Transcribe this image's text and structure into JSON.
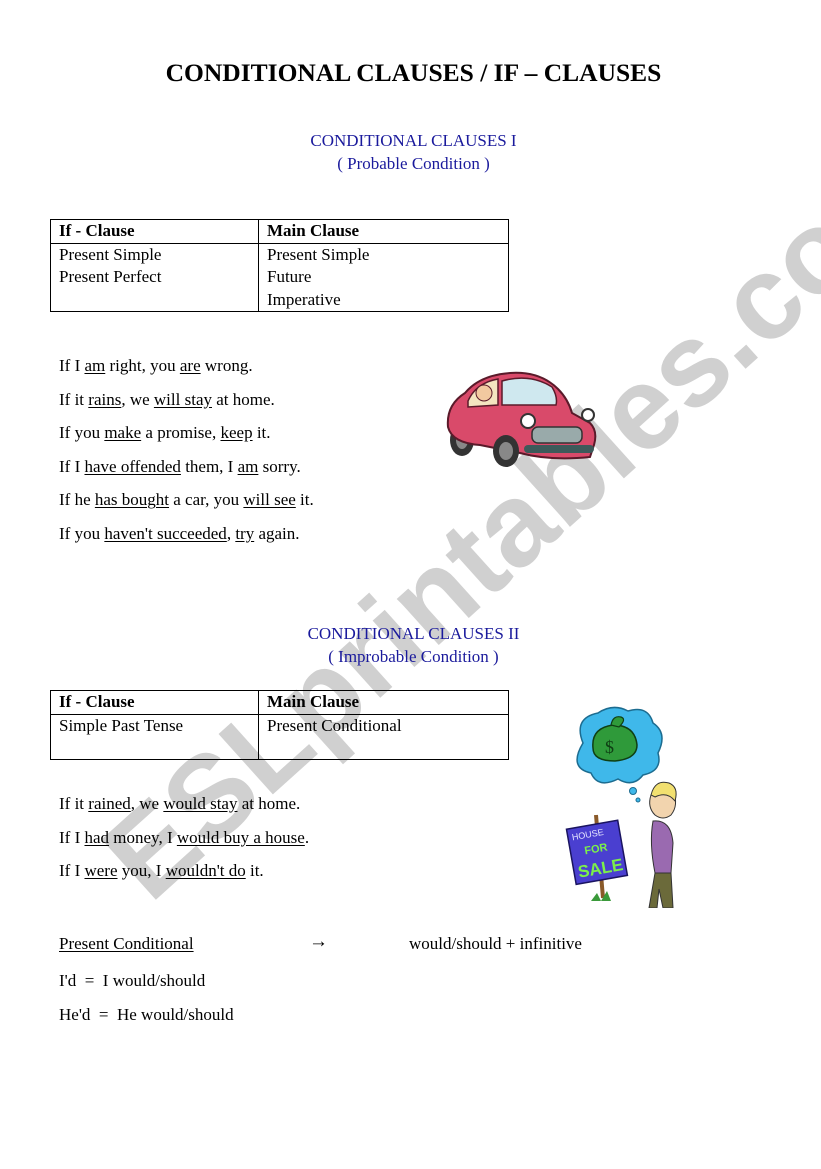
{
  "watermark": "ESLprintables.com",
  "title": "CONDITIONAL CLAUSES / IF – CLAUSES",
  "colors": {
    "heading_blue": "#1a1a9c",
    "watermark_gray": "#c8c8c8",
    "car_body": "#d94a6a",
    "bubble": "#3fb8ea",
    "sign": "#4a3fd0"
  },
  "section1": {
    "heading": "CONDITIONAL CLAUSES I",
    "subheading": "( Probable Condition )",
    "table": {
      "headers": [
        "If - Clause",
        "Main Clause"
      ],
      "if_clause": [
        "Present Simple",
        "Present Perfect"
      ],
      "main_clause": [
        "Present Simple",
        "Future",
        "Imperative"
      ]
    },
    "examples": [
      [
        {
          "t": "If I "
        },
        {
          "t": "am",
          "u": true
        },
        {
          "t": " right, you "
        },
        {
          "t": "are",
          "u": true
        },
        {
          "t": " wrong."
        }
      ],
      [
        {
          "t": "If it "
        },
        {
          "t": "rains",
          "u": true
        },
        {
          "t": ", we "
        },
        {
          "t": "will stay",
          "u": true
        },
        {
          "t": " at home."
        }
      ],
      [
        {
          "t": "If you "
        },
        {
          "t": "make",
          "u": true
        },
        {
          "t": " a promise, "
        },
        {
          "t": "keep",
          "u": true
        },
        {
          "t": " it."
        }
      ],
      [
        {
          "t": "If I "
        },
        {
          "t": "have offended",
          "u": true
        },
        {
          "t": " them, I "
        },
        {
          "t": "am",
          "u": true
        },
        {
          "t": " sorry."
        }
      ],
      [
        {
          "t": "If he "
        },
        {
          "t": "has bought",
          "u": true
        },
        {
          "t": " a car, you "
        },
        {
          "t": "will see",
          "u": true
        },
        {
          "t": " it."
        }
      ],
      [
        {
          "t": "If you "
        },
        {
          "t": "haven't succeeded",
          "u": true
        },
        {
          "t": ", "
        },
        {
          "t": "try",
          "u": true
        },
        {
          "t": " again."
        }
      ]
    ],
    "image": "car-with-driver-clipart"
  },
  "section2": {
    "heading": "CONDITIONAL CLAUSES II",
    "subheading": "( Improbable Condition )",
    "table": {
      "headers": [
        "If - Clause",
        "Main Clause"
      ],
      "if_clause": [
        "Simple Past Tense"
      ],
      "main_clause": [
        "Present Conditional"
      ]
    },
    "examples": [
      [
        {
          "t": "If it "
        },
        {
          "t": "rained",
          "u": true
        },
        {
          "t": ", we "
        },
        {
          "t": "would stay",
          "u": true
        },
        {
          "t": " at home."
        }
      ],
      [
        {
          "t": "If I "
        },
        {
          "t": "had",
          "u": true
        },
        {
          "t": " money, I "
        },
        {
          "t": "would buy a house",
          "u": true
        },
        {
          "t": "."
        }
      ],
      [
        {
          "t": "If I "
        },
        {
          "t": "were",
          "u": true
        },
        {
          "t": " you, I "
        },
        {
          "t": "wouldn't do",
          "u": true
        },
        {
          "t": " it."
        }
      ]
    ],
    "image": "man-dreaming-money-house-for-sale-clipart",
    "sign_text": [
      "HOUSE",
      "FOR",
      "SALE"
    ],
    "money_symbol": "$"
  },
  "present_conditional": {
    "label": "Present Conditional",
    "arrow": "→",
    "formula": "would/should + infinitive",
    "contractions": [
      "I'd  =  I would/should",
      "He'd  =  He would/should"
    ]
  }
}
